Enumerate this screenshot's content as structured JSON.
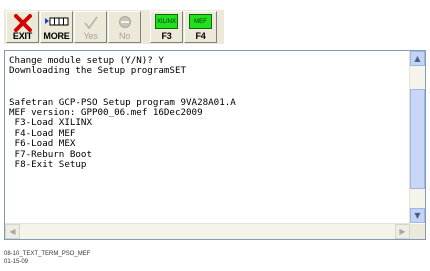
{
  "toolbar": {
    "exit_label": "EXIT",
    "more_label": "MORE",
    "yes_label": "Yes",
    "no_label": "No",
    "f3_label": "F3",
    "f4_label": "F4",
    "f3_chip": "XILINX",
    "f4_chip": "MEF"
  },
  "terminal": {
    "lines": [
      "Change module setup (Y/N)? Y",
      "Downloading the Setup programSET",
      "",
      "",
      "Safetran GCP-PSO Setup program 9VA28A01.A",
      "MEF version: GPP00_06.mef 16Dec2009",
      " F3-Load XILINX",
      " F4-Load MEF",
      " F6-Load MEX",
      " F7-Reburn Boot",
      " F8-Exit Setup"
    ]
  },
  "caption": {
    "line1": "08-10_TEXT_TERM_PSO_MEF",
    "line2": "01-15-09"
  },
  "colors": {
    "exit_x": "#d40000",
    "chip_green": "#22e01f",
    "window_bg": "#ece9d8",
    "scrollbar_blue": "#c4d4f7"
  }
}
